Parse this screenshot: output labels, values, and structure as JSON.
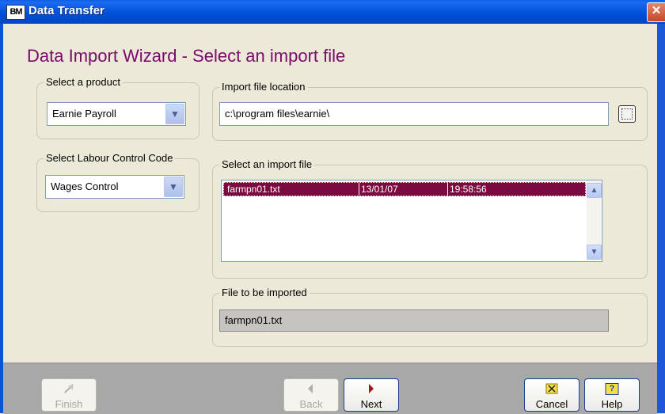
{
  "window": {
    "title": "Data Transfer",
    "icon_text": "BM",
    "close_glyph": "✕"
  },
  "page": {
    "heading": "Data Import Wizard - Select an import file"
  },
  "product": {
    "label": "Select a product",
    "value": "Earnie Payroll"
  },
  "labour": {
    "label": "Select Labour Control Code",
    "value": "Wages Control"
  },
  "location": {
    "label": "Import file location",
    "value": "c:\\program files\\earnie\\"
  },
  "import_list": {
    "label": "Select an import file",
    "rows": [
      {
        "name": "farmpn01.txt",
        "date": "13/01/07",
        "time": "19:58:56",
        "selected": true
      }
    ]
  },
  "to_import": {
    "label": "File to be imported",
    "value": "farmpn01.txt"
  },
  "buttons": {
    "finish": "Finish",
    "back": "Back",
    "next": "Next",
    "cancel": "Cancel",
    "help": "Help",
    "help_glyph": "?"
  },
  "icons": {
    "dropdown": "chevron-down-icon",
    "scroll_up": "scroll-up-icon",
    "scroll_down": "scroll-down-icon",
    "browse": "browse-icon",
    "finish": "finish-flag-icon",
    "back": "back-arrow-icon",
    "next": "next-arrow-icon",
    "cancel": "cancel-x-icon",
    "help": "help-icon"
  },
  "colors": {
    "heading": "#7a0a6a",
    "selection": "#7b0a40",
    "titlebar": "#0050d8",
    "footer": "#a8a8a8"
  }
}
